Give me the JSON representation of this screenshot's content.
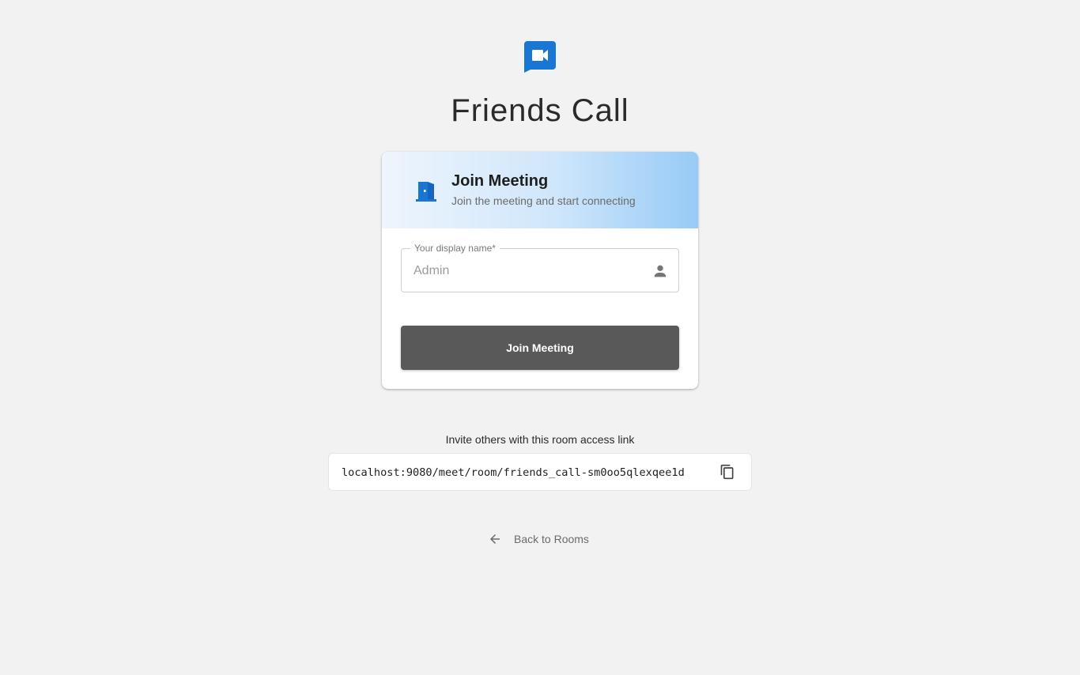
{
  "app": {
    "title": "Friends Call",
    "logo_icon": "video-chat-icon",
    "accent_color": "#1976d2"
  },
  "card": {
    "icon": "door-icon",
    "title": "Join Meeting",
    "subtitle": "Join the meeting and start connecting",
    "display_name_field": {
      "label": "Your display name*",
      "placeholder": "Admin",
      "value": "",
      "icon": "person-icon"
    },
    "join_button_label": "Join Meeting"
  },
  "invite": {
    "text": "Invite others with this room access link",
    "link": "localhost:9080/meet/room/friends_call-sm0oo5qlexqee1d",
    "copy_icon": "copy-icon"
  },
  "back": {
    "label": "Back to Rooms",
    "icon": "arrow-left-icon"
  }
}
